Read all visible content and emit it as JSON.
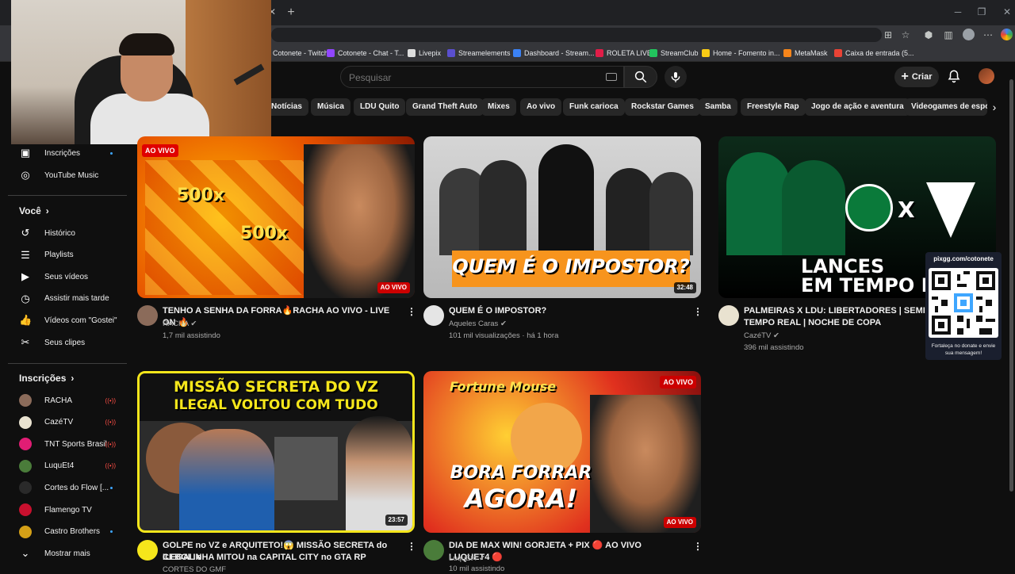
{
  "browser": {
    "bookmarks": [
      {
        "label": "Cotonete - Twitch",
        "color": "#9146ff"
      },
      {
        "label": "Cotonete - Chat - T...",
        "color": "#9146ff"
      },
      {
        "label": "Livepix",
        "color": "#dddddd"
      },
      {
        "label": "Streamelements",
        "color": "#5a4fcf"
      },
      {
        "label": "Dashboard - Stream...",
        "color": "#3b82f6"
      },
      {
        "label": "ROLETA LIVE",
        "color": "#e11d48"
      },
      {
        "label": "StreamClub",
        "color": "#22c55e"
      },
      {
        "label": "Home - Fomento in...",
        "color": "#facc15"
      },
      {
        "label": "MetaMask",
        "color": "#f6851b"
      },
      {
        "label": "Caixa de entrada (5...",
        "color": "#ea4335"
      }
    ]
  },
  "header": {
    "search_placeholder": "Pesquisar",
    "create_label": "Criar"
  },
  "chips": [
    "Notícias",
    "Música",
    "LDU Quito",
    "Grand Theft Auto",
    "Mixes",
    "Ao vivo",
    "Funk carioca",
    "Rockstar Games",
    "Samba",
    "Freestyle Rap",
    "Jogo de ação e aventura",
    "Videogames de esport"
  ],
  "sidebar": {
    "top_items": [
      {
        "label": "Inscrições",
        "icon": "subscriptions-icon",
        "glyph": "▣"
      },
      {
        "label": "YouTube Music",
        "icon": "youtube-music-icon",
        "glyph": "◎"
      }
    ],
    "you_heading": "Você",
    "you_items": [
      {
        "label": "Histórico",
        "icon": "history-icon",
        "glyph": "↺"
      },
      {
        "label": "Playlists",
        "icon": "playlists-icon",
        "glyph": "☰"
      },
      {
        "label": "Seus vídeos",
        "icon": "your-videos-icon",
        "glyph": "▶"
      },
      {
        "label": "Assistir mais tarde",
        "icon": "watch-later-icon",
        "glyph": "◷"
      },
      {
        "label": "Vídeos com \"Gostei\"",
        "icon": "liked-icon",
        "glyph": "👍"
      },
      {
        "label": "Seus clipes",
        "icon": "clips-icon",
        "glyph": "✂"
      }
    ],
    "subs_heading": "Inscrições",
    "subscriptions": [
      {
        "label": "RACHA",
        "color": "#8b6b5a",
        "status": "live"
      },
      {
        "label": "CazéTV",
        "color": "#e9e2d0",
        "status": "live"
      },
      {
        "label": "TNT Sports Brasil",
        "color": "#e11d74",
        "status": "live"
      },
      {
        "label": "LuquEt4",
        "color": "#4a7c3a",
        "status": "live"
      },
      {
        "label": "Cortes do Flow [...",
        "color": "#2a2a2a",
        "status": "new"
      },
      {
        "label": "Flamengo TV",
        "color": "#c8102e",
        "status": "none"
      },
      {
        "label": "Castro Brothers",
        "color": "#d4a017",
        "status": "new"
      }
    ],
    "show_more": "Mostrar mais"
  },
  "videos": [
    {
      "thumb_text": "500x",
      "badge": "AO VIVO",
      "badge_type": "live",
      "top_badge": "AO VIVO",
      "title_line1": "TENHO A SENHA DA FORRA🔥RACHA  AO VIVO - LIVE ON 🔥",
      "title_line2": "",
      "channel": "RACHA",
      "meta": "1,7 mil assistindo"
    },
    {
      "thumb_text": "QUEM É O IMPOSTOR?",
      "badge": "32:48",
      "badge_type": "time",
      "title_line1": "QUEM É O IMPOSTOR?",
      "title_line2": "",
      "channel": "Aqueles Caras",
      "meta": "101 mil visualizações · há 1 hora"
    },
    {
      "thumb_text": "LANCES EM TEMPO RI",
      "thumb_text_line1": "LANCES",
      "thumb_text_line2": "EM TEMPO RI",
      "badge": "",
      "badge_type": "none",
      "title_line1": "PALMEIRAS X LDU: LIBERTADORES | SEMIFINAI",
      "title_line2": "TEMPO REAL | NOCHE DE COPA",
      "channel": "CazéTV",
      "meta": "396 mil assistindo"
    },
    {
      "thumb_text_line1": "MISSÃO SECRETA DO VZ",
      "thumb_text_line2": "ILEGAL VOLTOU COM TUDO",
      "badge": "23:57",
      "badge_type": "time",
      "title_line1": "GOLPE no VZ e ARQUITETO!😱 MISSÃO SECRETA do ILEGAL e",
      "title_line2": "CEBOLINHA MITOU na CAPITAL CITY no GTA RP",
      "channel": "CORTES DO GMF",
      "meta": ""
    },
    {
      "thumb_text_line1": "BORA FORRAR",
      "thumb_text_line2": "AGORA!",
      "thumb_top": "Fortune Mouse",
      "top_badge": "AO VIVO",
      "badge": "AO VIVO",
      "badge_type": "live",
      "title_line1": "DIA DE MAX WIN! GORJETA + PIX 🔴 AO VIVO LUQUET4 🔴",
      "title_line2": "",
      "channel": "LuquEt4",
      "meta": "10 mil assistindo"
    }
  ],
  "overlay": {
    "qr_url": "pixgg.com/cotonete",
    "qr_message": "Fortaleça no donate e envie sua mensagem!"
  }
}
